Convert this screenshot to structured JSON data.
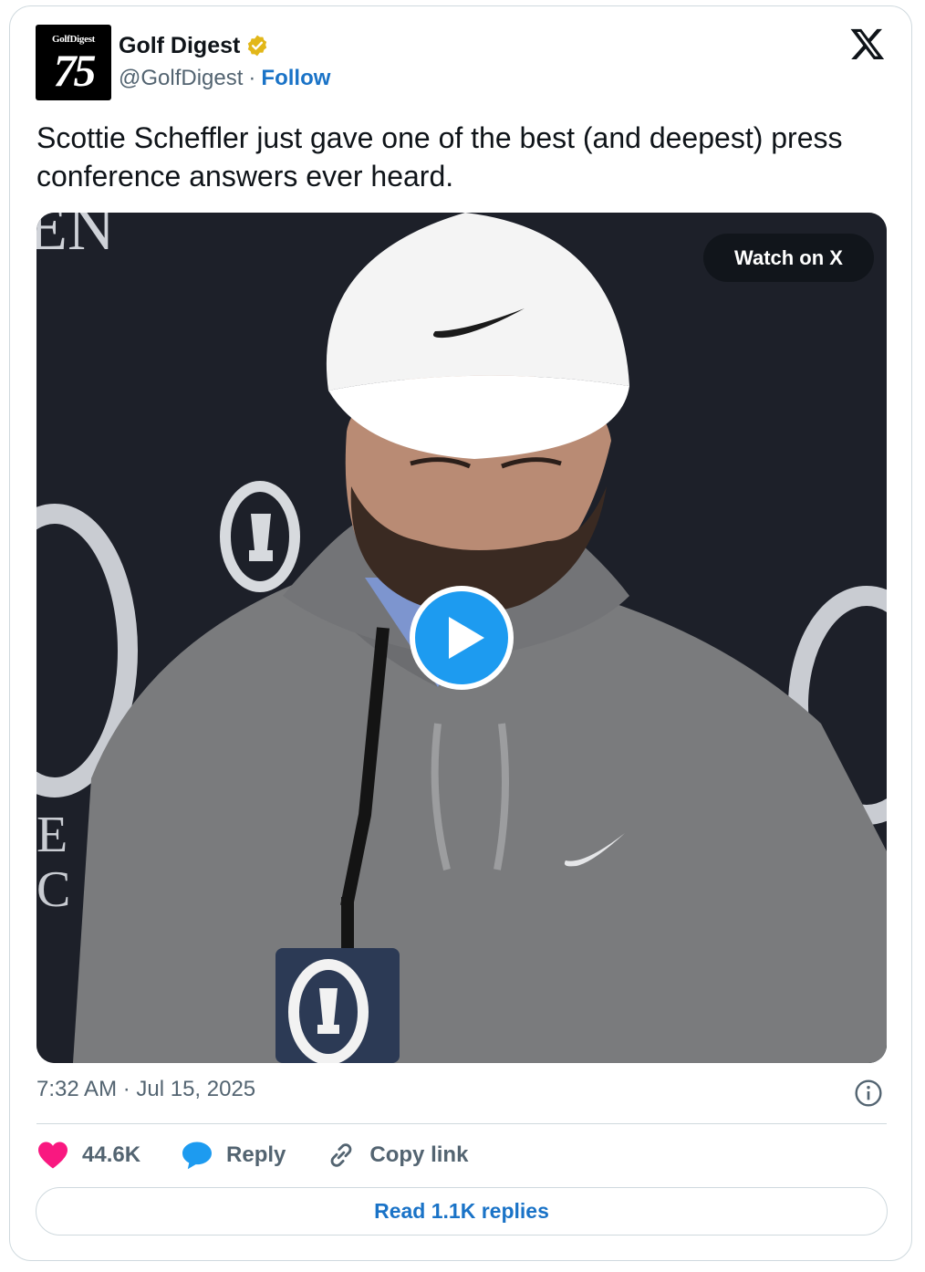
{
  "author": {
    "avatar_brand": "GolfDigest",
    "avatar_number": "75",
    "display_name": "Golf Digest",
    "handle": "@GolfDigest",
    "separator": "·",
    "follow_label": "Follow"
  },
  "tweet": {
    "text": "Scottie Scheffler just gave one of the best (and deepest) press conference answers ever heard."
  },
  "media": {
    "watch_label": "Watch on X",
    "background_letters_left": "EN",
    "podium_letter": "O"
  },
  "meta": {
    "timestamp": "7:32 AM · Jul 15, 2025"
  },
  "actions": {
    "likes": "44.6K",
    "reply_label": "Reply",
    "copy_label": "Copy link"
  },
  "read_replies_label": "Read 1.1K replies",
  "colors": {
    "accent": "#1a73c7",
    "like": "#f91880",
    "reply": "#1d9bf0",
    "verified": "#e2b719"
  }
}
